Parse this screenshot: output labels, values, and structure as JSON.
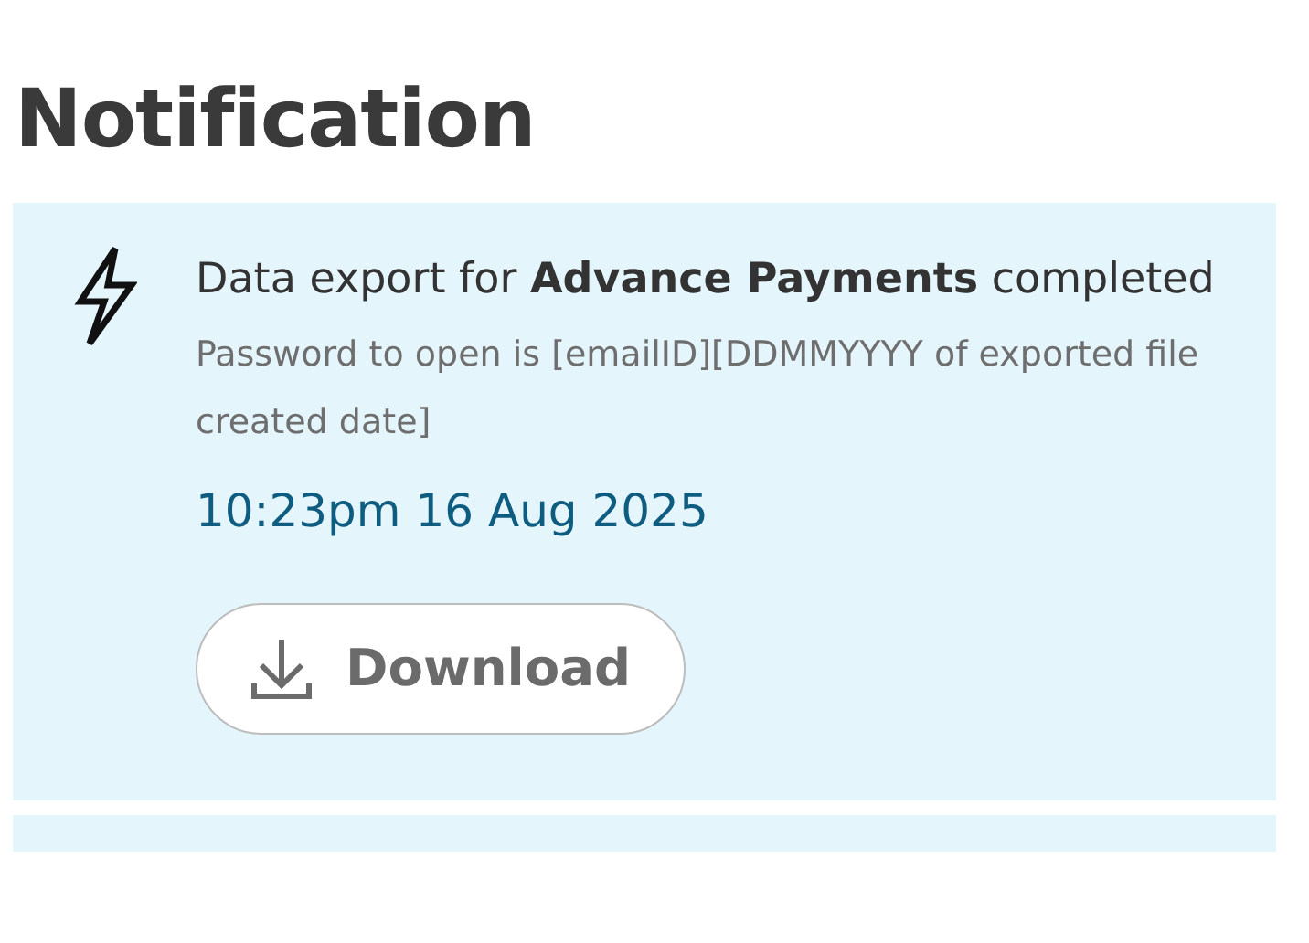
{
  "page": {
    "title": "Notification"
  },
  "notifications": [
    {
      "kind": "export",
      "unread": true,
      "message": "Data export for **Advance Payments** completed",
      "detail": "Password to open is [emailID][DDMMYYYY of exported file created date]",
      "time": "10:23pm 16 Aug 2025",
      "action": "Download"
    }
  ]
}
